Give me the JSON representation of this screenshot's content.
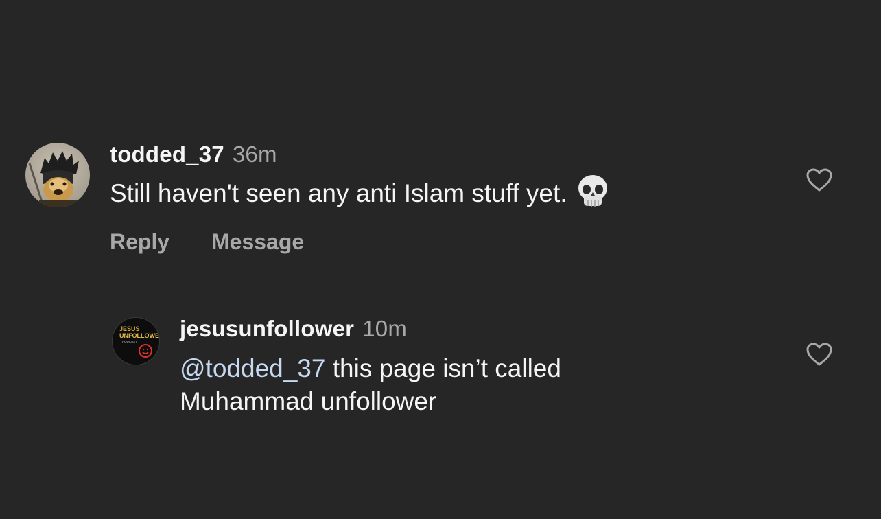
{
  "comment": {
    "username": "todded_37",
    "time": "36m",
    "text": "Still haven't seen any anti Islam stuff yet.",
    "emoji": "skull-emoji",
    "actions": {
      "reply": "Reply",
      "message": "Message"
    }
  },
  "reply": {
    "username": "jesusunfollower",
    "time": "10m",
    "mention": "@todded_37",
    "text_line1": " this page isn’t called",
    "text_line2": "Muhammad unfollower",
    "avatar_logo": {
      "line1": "JESUS",
      "line2": "UNFOLLOWER",
      "line3": "PODCAST"
    }
  },
  "colors": {
    "background": "#262626",
    "text_primary": "#f5f5f5",
    "text_secondary": "#a8a8a8",
    "mention": "#c7d9f2"
  }
}
